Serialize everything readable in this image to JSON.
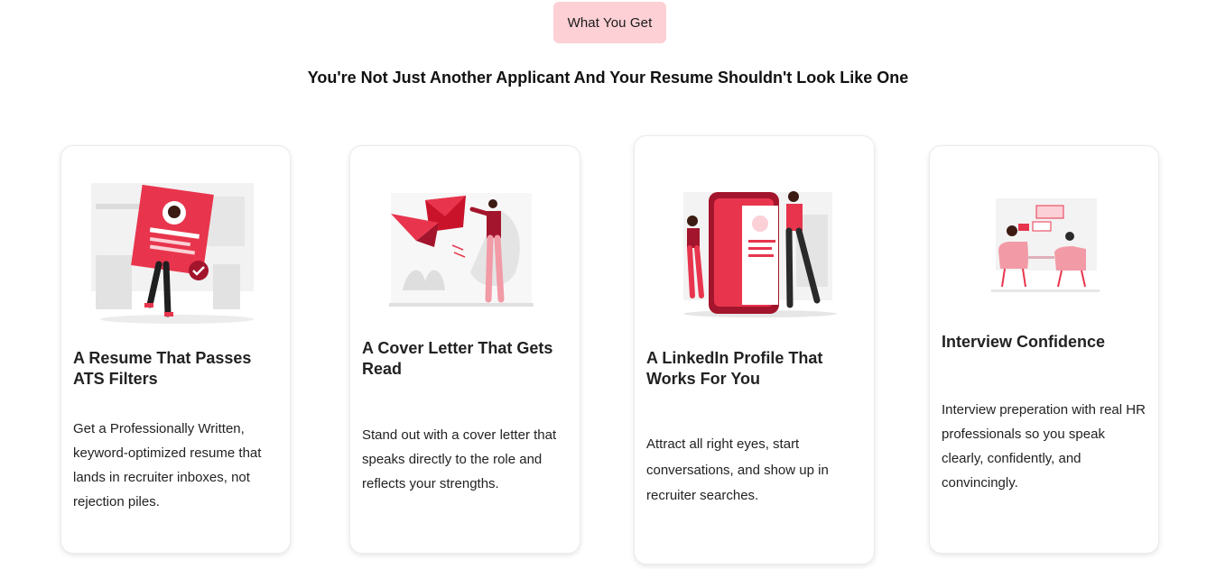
{
  "badge": {
    "label": "What You Get"
  },
  "heading": "You're Not Just Another Applicant And Your Resume Shouldn't Look Like One",
  "cards": [
    {
      "title": "A Resume That Passes ATS Filters",
      "description": "Get a Professionally Written, keyword-optimized resume that lands in recruiter inboxes, not rejection piles.",
      "illustration": "resume-illustration"
    },
    {
      "title": "A Cover Letter That Gets Read",
      "description": "Stand out with a cover letter that speaks directly to the role and reflects your strengths.",
      "illustration": "cover-letter-illustration"
    },
    {
      "title": "A LinkedIn Profile That Works For You",
      "description": "Attract all right eyes, start conversations, and show up in recruiter searches.",
      "illustration": "linkedin-profile-illustration"
    },
    {
      "title": "Interview Confidence",
      "description": "Interview preperation with real HR professionals so you speak clearly, confidently, and convincingly.",
      "illustration": "interview-illustration"
    }
  ],
  "colors": {
    "accent": "#e8354d",
    "badge_bg": "#fcd0d4",
    "dark": "#a3152c"
  }
}
